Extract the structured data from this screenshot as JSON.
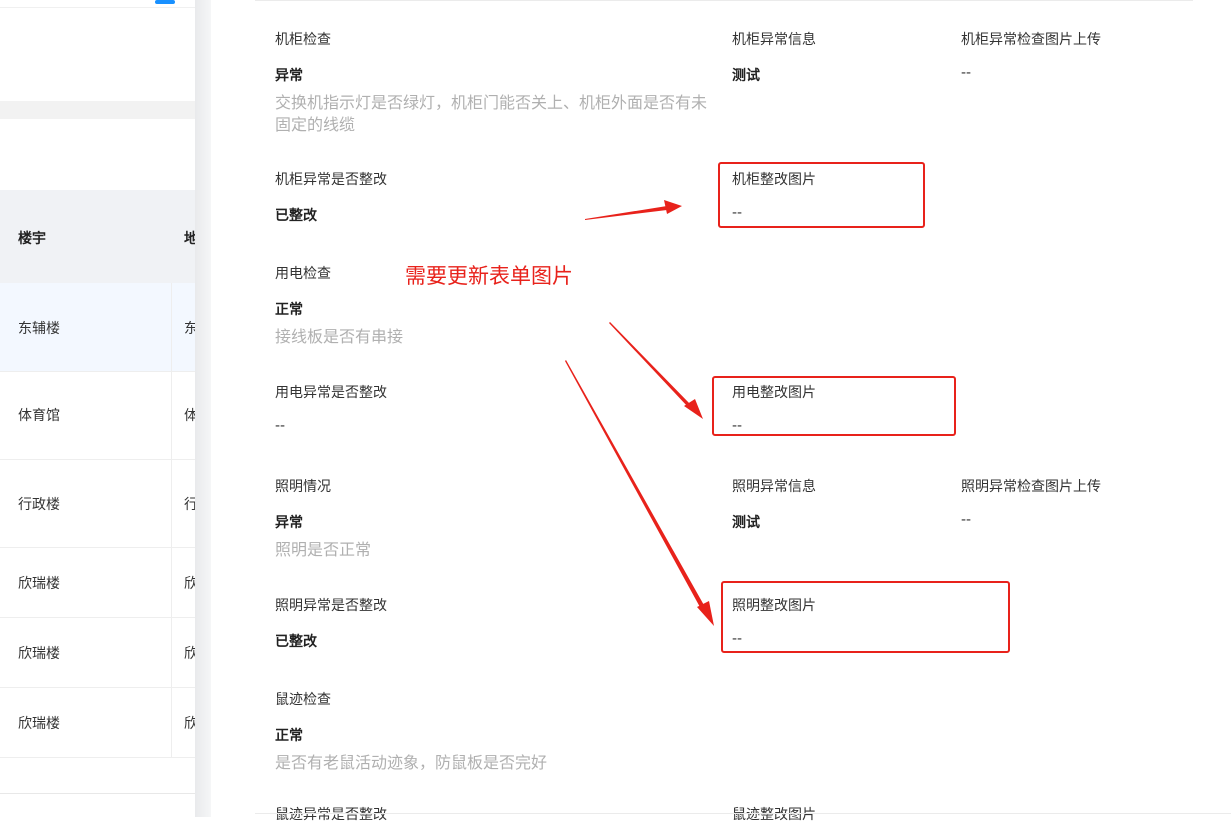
{
  "background_table": {
    "headers": {
      "building": "楼宇",
      "address": "地"
    },
    "rows": [
      {
        "building": "东辅楼",
        "address": "东"
      },
      {
        "building": "体育馆",
        "address": "体"
      },
      {
        "building": "行政楼",
        "address": "行"
      },
      {
        "building": "欣瑞楼",
        "address": "欣"
      },
      {
        "building": "欣瑞楼",
        "address": "欣"
      },
      {
        "building": "欣瑞楼",
        "address": "欣"
      }
    ]
  },
  "drawer": {
    "cabinet_check": {
      "label": "机柜检查",
      "value": "异常",
      "desc": "交换机指示灯是否绿灯，机柜门能否关上、机柜外面是否有未固定的线缆"
    },
    "cabinet_abnormal_info": {
      "label": "机柜异常信息",
      "value": "测试"
    },
    "cabinet_abnormal_image": {
      "label": "机柜异常检查图片上传",
      "value": "--"
    },
    "cabinet_fixed": {
      "label": "机柜异常是否整改",
      "value": "已整改"
    },
    "cabinet_fix_image": {
      "label": "机柜整改图片",
      "value": "--"
    },
    "power_check": {
      "label": "用电检查",
      "value": "正常",
      "desc": "接线板是否有串接"
    },
    "power_fixed": {
      "label": "用电异常是否整改",
      "value": "--"
    },
    "power_fix_image": {
      "label": "用电整改图片",
      "value": "--"
    },
    "lighting_check": {
      "label": "照明情况",
      "value": "异常",
      "desc": "照明是否正常"
    },
    "lighting_abnormal_info": {
      "label": "照明异常信息",
      "value": "测试"
    },
    "lighting_abnormal_image": {
      "label": "照明异常检查图片上传",
      "value": "--"
    },
    "lighting_fixed": {
      "label": "照明异常是否整改",
      "value": "已整改"
    },
    "lighting_fix_image": {
      "label": "照明整改图片",
      "value": "--"
    },
    "rodent_check": {
      "label": "鼠迹检查",
      "value": "正常",
      "desc": "是否有老鼠活动迹象，防鼠板是否完好"
    },
    "rodent_fixed": {
      "label": "鼠迹异常是否整改"
    },
    "rodent_fix_image": {
      "label": "鼠迹整改图片"
    }
  },
  "annotation": {
    "text": "需要更新表单图片",
    "color": "#e8221b"
  }
}
